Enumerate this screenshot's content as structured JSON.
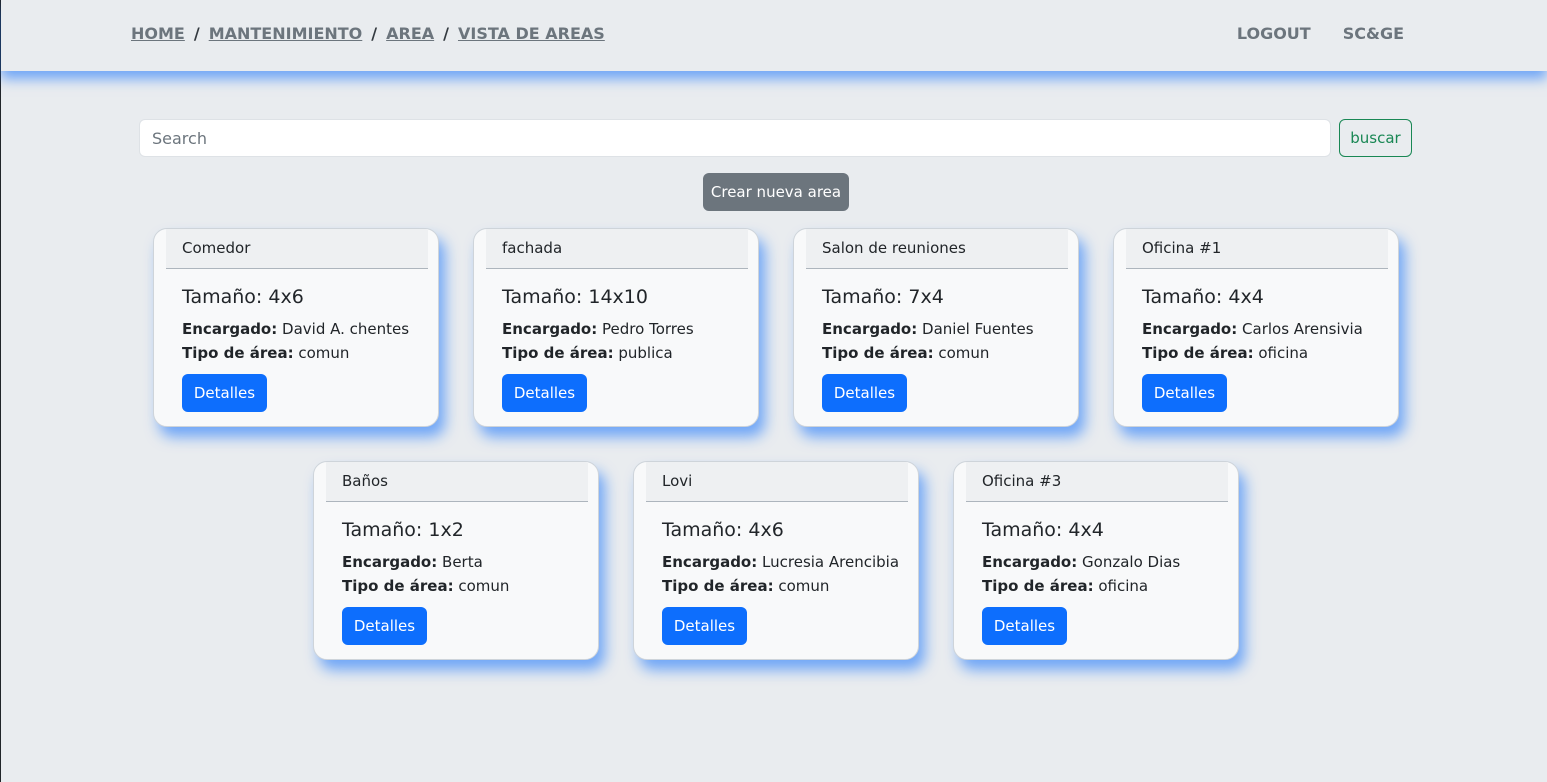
{
  "breadcrumb": {
    "items": [
      "HOME",
      "MANTENIMIENTO",
      "AREA",
      "VISTA DE AREAS"
    ],
    "separator": "/"
  },
  "nav": {
    "logout": "LOGOUT",
    "brand": "SC&GE"
  },
  "search": {
    "placeholder": "Search",
    "value": "",
    "button_label": "buscar"
  },
  "create_button_label": "Crear nueva area",
  "labels": {
    "size_prefix": "Tamaño: ",
    "manager": "Encargado:",
    "area_type": "Tipo de área:",
    "details_button": "Detalles"
  },
  "areas": [
    {
      "name": "Comedor",
      "size": "4x6",
      "manager": "David A. chentes",
      "type": "comun"
    },
    {
      "name": "fachada",
      "size": "14x10",
      "manager": "Pedro Torres",
      "type": "publica"
    },
    {
      "name": "Salon de reuniones",
      "size": "7x4",
      "manager": "Daniel Fuentes",
      "type": "comun"
    },
    {
      "name": "Oficina #1",
      "size": "4x4",
      "manager": "Carlos Arensivia",
      "type": "oficina"
    },
    {
      "name": "Baños",
      "size": "1x2",
      "manager": "Berta",
      "type": "comun"
    },
    {
      "name": "Lovi",
      "size": "4x6",
      "manager": "Lucresia Arencibia",
      "type": "comun"
    },
    {
      "name": "Oficina #3",
      "size": "4x4",
      "manager": "Gonzalo Dias",
      "type": "oficina"
    }
  ],
  "colors": {
    "background": "#e9ecef",
    "primary": "#0d6efd",
    "success": "#198754",
    "secondary": "#6c757d"
  }
}
